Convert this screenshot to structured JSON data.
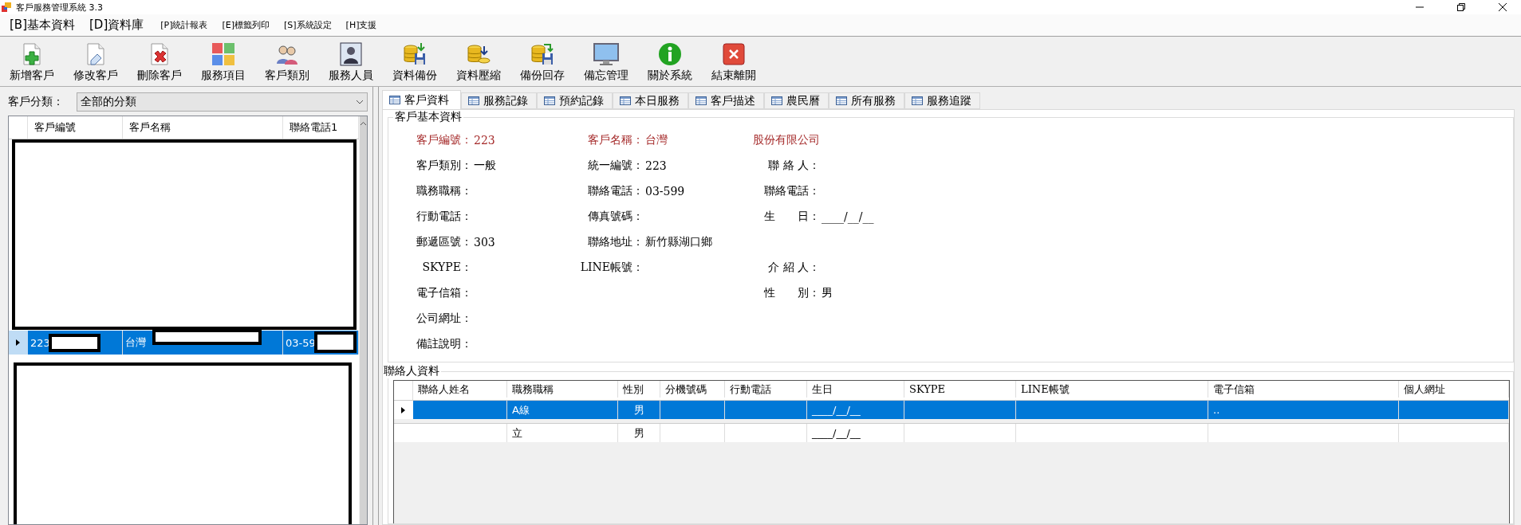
{
  "window": {
    "title": "客戶服務管理系統 3.3"
  },
  "menu": [
    {
      "label": "[B]基本資料",
      "kind": "large"
    },
    {
      "label": "[D]資料庫",
      "kind": "large"
    },
    {
      "label": "[P]統計報表",
      "kind": "small"
    },
    {
      "label": "[E]標籤列印",
      "kind": "small"
    },
    {
      "label": "[S]系統設定",
      "kind": "small"
    },
    {
      "label": "[H]支援",
      "kind": "small"
    }
  ],
  "toolbar": [
    {
      "label": "新增客戶"
    },
    {
      "label": "修改客戶"
    },
    {
      "label": "刪除客戶"
    },
    {
      "label": "服務項目"
    },
    {
      "label": "客戶類別"
    },
    {
      "label": "服務人員"
    },
    {
      "label": "資料備份"
    },
    {
      "label": "資料壓縮"
    },
    {
      "label": "備份回存"
    },
    {
      "label": "備忘管理"
    },
    {
      "label": "關於系統"
    },
    {
      "label": "結束離開"
    }
  ],
  "customer_list": {
    "filter_label": "客戶分類：",
    "filter_value": "全部的分類",
    "columns": [
      "客戶編號",
      "客戶名稱",
      "聯絡電話1"
    ],
    "rows": [
      {
        "cells": [
          "223",
          "台灣",
          "03-59"
        ],
        "selected": true
      }
    ]
  },
  "tabs": [
    {
      "label": "客戶資料",
      "selected": true
    },
    {
      "label": "服務記錄",
      "selected": false
    },
    {
      "label": "預約記錄",
      "selected": false
    },
    {
      "label": "本日服務",
      "selected": false
    },
    {
      "label": "客戶描述",
      "selected": false
    },
    {
      "label": "農民曆",
      "selected": false
    },
    {
      "label": "所有服務",
      "selected": false
    },
    {
      "label": "服務追蹤",
      "selected": false
    }
  ],
  "customer_info": {
    "title": "客戶基本資料",
    "rows": [
      [
        {
          "label": "客戶編號：",
          "value": "223",
          "emphasis": true
        },
        {
          "label": "客戶名稱：",
          "value": "台灣",
          "emphasis": true
        },
        {
          "value": "股份有限公司",
          "emphasis": true
        }
      ],
      [
        {
          "label": "客戶類別：",
          "value": "一般",
          "emphasis": false
        },
        {
          "label": "統一編號：",
          "value": "223",
          "emphasis": false
        },
        {
          "label": "聯 絡 人：",
          "emphasis": false
        }
      ],
      [
        {
          "label": "職務職稱：",
          "emphasis": false
        },
        {
          "label": "聯絡電話：",
          "value": "03-599",
          "emphasis": false
        },
        {
          "label": "聯絡電話：",
          "emphasis": false
        }
      ],
      [
        {
          "label": "行動電話：",
          "emphasis": false
        },
        {
          "label": "傳真號碼：",
          "emphasis": false
        },
        {
          "label": "生　　日：",
          "value": "____/__/__",
          "emphasis": false
        }
      ],
      [
        {
          "label": "郵遞區號：",
          "value": "303",
          "emphasis": false
        },
        {
          "label": "聯絡地址：",
          "value": "新竹縣湖口鄉",
          "emphasis": false
        }
      ],
      [
        {
          "label": "SKYPE：",
          "emphasis": false
        },
        {
          "label": "LINE帳號：",
          "emphasis": false
        },
        {
          "label": "介 紹 人：",
          "emphasis": false
        }
      ],
      [
        {
          "label": "電子信箱：",
          "emphasis": false
        },
        {},
        {
          "label": "性　　別：",
          "value": "男",
          "emphasis": false
        }
      ],
      [
        {
          "label": "公司網址：",
          "emphasis": false
        }
      ],
      [
        {
          "label": "備註說明：",
          "emphasis": false
        }
      ]
    ]
  },
  "contacts": {
    "title": "聯絡人資料",
    "columns": [
      "聯絡人姓名",
      "職務職稱",
      "性別",
      "分機號碼",
      "行動電話",
      "生日",
      "SKYPE",
      "LINE帳號",
      "電子信箱",
      "個人網址"
    ],
    "rows": [
      {
        "cells": [
          "",
          "A線",
          "男",
          "",
          "",
          "____/__/__",
          "",
          "",
          "..",
          ""
        ],
        "selected": true
      },
      {
        "cells": [
          "",
          "立",
          "男",
          "",
          "",
          "____/__/__",
          "",
          "",
          "",
          ""
        ],
        "selected": false
      }
    ]
  }
}
